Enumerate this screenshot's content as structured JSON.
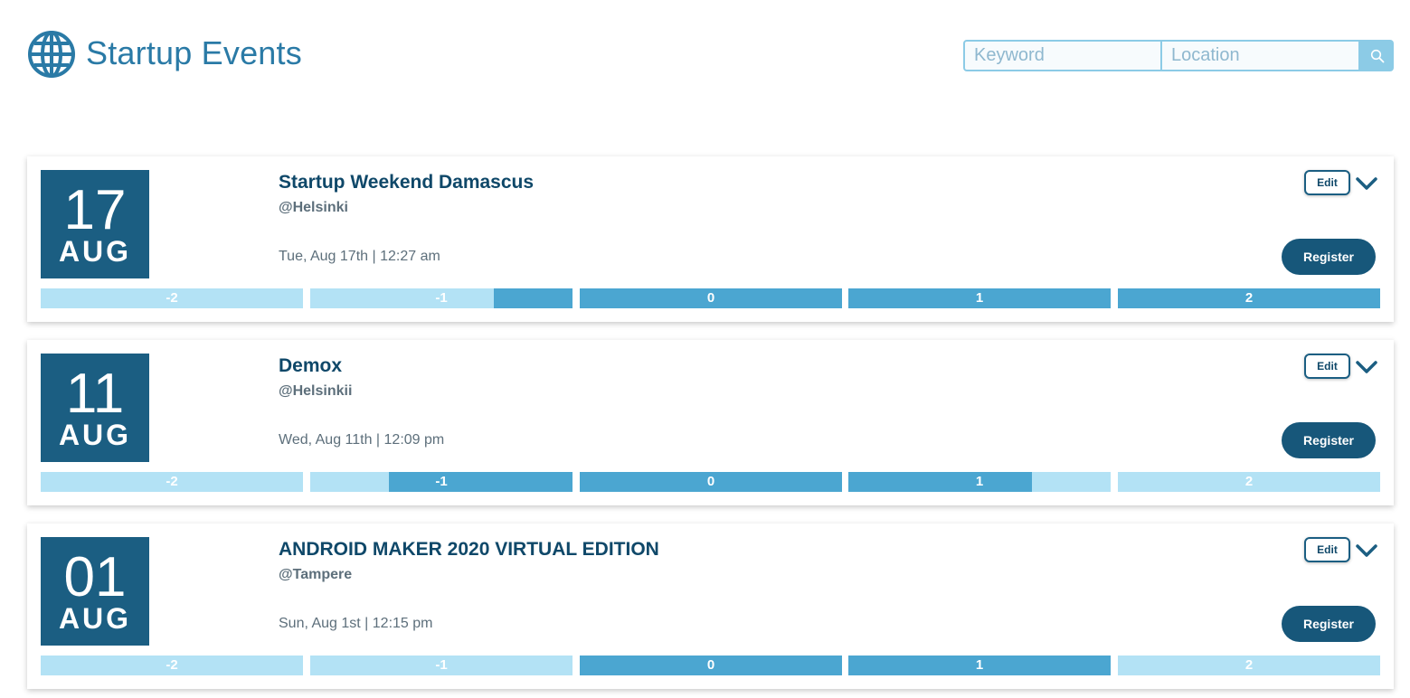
{
  "app": {
    "title": "Startup Events",
    "brand_color": "#1b5e82",
    "accent_color": "#4ba6d1",
    "light_color": "#b3e2f5",
    "logo_icon": "globe-icon"
  },
  "search": {
    "keyword_placeholder": "Keyword",
    "keyword_value": "",
    "location_placeholder": "Location",
    "location_value": "",
    "button_icon": "search-icon"
  },
  "events": [
    {
      "day": "17",
      "month": "AUG",
      "name": "Startup Weekend Damascus",
      "location": "@Helsinki",
      "datetime": "Tue, Aug 17th | 12:27 am",
      "edit_label": "Edit",
      "register_label": "Register",
      "expand_icon": "chevron-down-icon",
      "scale": [
        {
          "label": "-2",
          "fill_left": 0,
          "fill_right": 0
        },
        {
          "label": "-1",
          "fill_left": 0.7,
          "fill_right": 1
        },
        {
          "label": "0",
          "fill_left": 0,
          "fill_right": 1
        },
        {
          "label": "1",
          "fill_left": 0,
          "fill_right": 1
        },
        {
          "label": "2",
          "fill_left": 0,
          "fill_right": 1
        }
      ]
    },
    {
      "day": "11",
      "month": "AUG",
      "name": "Demox",
      "location": "@Helsinkii",
      "datetime": "Wed, Aug 11th | 12:09 pm",
      "edit_label": "Edit",
      "register_label": "Register",
      "expand_icon": "chevron-down-icon",
      "scale": [
        {
          "label": "-2",
          "fill_left": 0,
          "fill_right": 0
        },
        {
          "label": "-1",
          "fill_left": 0.3,
          "fill_right": 1
        },
        {
          "label": "0",
          "fill_left": 0,
          "fill_right": 1
        },
        {
          "label": "1",
          "fill_left": 0,
          "fill_right": 0.7
        },
        {
          "label": "2",
          "fill_left": 0,
          "fill_right": 0
        }
      ]
    },
    {
      "day": "01",
      "month": "AUG",
      "name": "ANDROID MAKER 2020 VIRTUAL EDITION",
      "location": "@Tampere",
      "datetime": "Sun, Aug 1st | 12:15 pm",
      "edit_label": "Edit",
      "register_label": "Register",
      "expand_icon": "chevron-down-icon",
      "scale": [
        {
          "label": "-2",
          "fill_left": 0,
          "fill_right": 0
        },
        {
          "label": "-1",
          "fill_left": 0,
          "fill_right": 0
        },
        {
          "label": "0",
          "fill_left": 0,
          "fill_right": 1
        },
        {
          "label": "1",
          "fill_left": 0,
          "fill_right": 1
        },
        {
          "label": "2",
          "fill_left": 0,
          "fill_right": 0
        }
      ]
    }
  ]
}
